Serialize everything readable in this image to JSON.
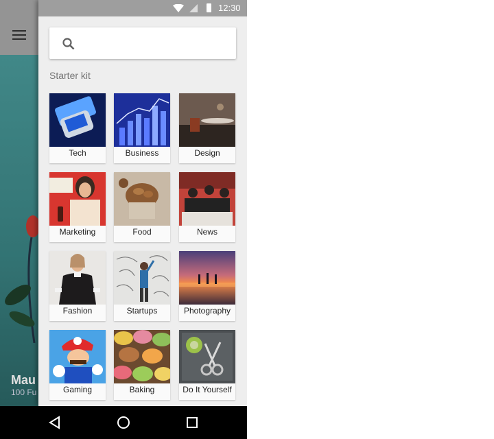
{
  "status_bar": {
    "time": "12:30"
  },
  "background_screen": {
    "title": "Mau",
    "subtitle": "100 Fu"
  },
  "search": {
    "placeholder": ""
  },
  "section": {
    "title": "Starter kit"
  },
  "categories": [
    {
      "label": "Tech",
      "thumb": "tech-thumbnail"
    },
    {
      "label": "Business",
      "thumb": "business-thumbnail"
    },
    {
      "label": "Design",
      "thumb": "design-thumbnail"
    },
    {
      "label": "Marketing",
      "thumb": "marketing-thumbnail"
    },
    {
      "label": "Food",
      "thumb": "food-thumbnail"
    },
    {
      "label": "News",
      "thumb": "news-thumbnail"
    },
    {
      "label": "Fashion",
      "thumb": "fashion-thumbnail"
    },
    {
      "label": "Startups",
      "thumb": "startups-thumbnail"
    },
    {
      "label": "Photography",
      "thumb": "photography-thumbnail"
    },
    {
      "label": "Gaming",
      "thumb": "gaming-thumbnail"
    },
    {
      "label": "Baking",
      "thumb": "baking-thumbnail"
    },
    {
      "label": "Do It Yourself",
      "thumb": "diy-thumbnail"
    }
  ],
  "colors": {
    "drawer_background": "#eeeeee",
    "status_bar": "#9e9e9e",
    "label_text": "#212121",
    "section_title": "#757575"
  },
  "icons": [
    "menu-icon",
    "wifi-icon",
    "signal-icon",
    "battery-icon",
    "search-icon",
    "back-icon",
    "home-icon",
    "recents-icon"
  ]
}
